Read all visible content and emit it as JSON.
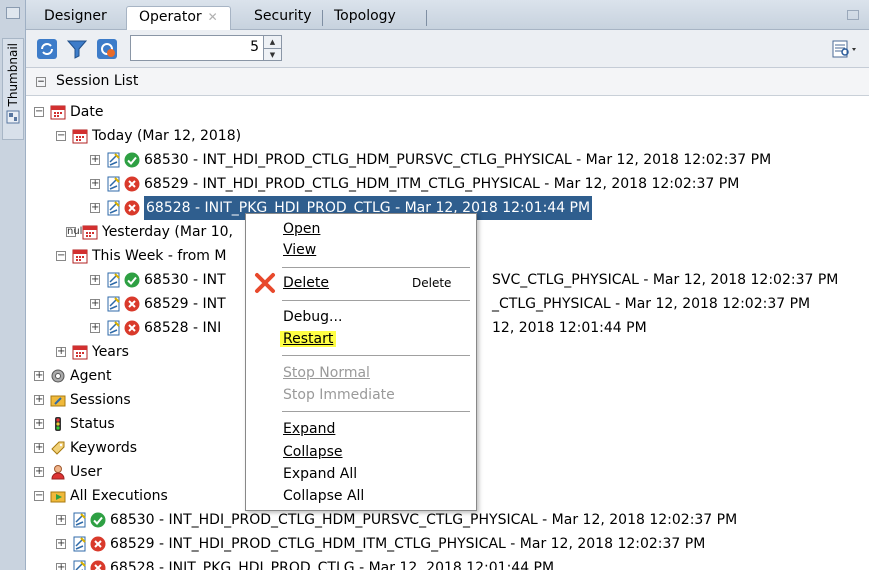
{
  "sidebar": {
    "label": "Thumbnail"
  },
  "tabs": [
    {
      "label": "Designer"
    },
    {
      "label": "Operator"
    },
    {
      "label": "Security"
    },
    {
      "label": "Topology"
    }
  ],
  "toolbar": {
    "spinner_value": "5"
  },
  "panel": {
    "title": "Session List"
  },
  "tree": {
    "date": "Date",
    "today": "Today (Mar 12, 2018)",
    "today_items": [
      {
        "text": "68530 - INT_HDI_PROD_CTLG_HDM_PURSVC_CTLG_PHYSICAL - Mar 12, 2018 12:02:37 PM",
        "status": "success"
      },
      {
        "text": "68529 - INT_HDI_PROD_CTLG_HDM_ITM_CTLG_PHYSICAL - Mar 12, 2018 12:02:37 PM",
        "status": "error"
      },
      {
        "text": "68528 - INIT_PKG_HDI_PROD_CTLG - Mar 12, 2018 12:01:44 PM",
        "status": "error"
      }
    ],
    "yesterday": "Yesterday (Mar 10,",
    "week": "This Week - from M",
    "week_items": [
      {
        "left": "68530 - INT",
        "right": "SVC_CTLG_PHYSICAL - Mar 12, 2018 12:02:37 PM",
        "status": "success"
      },
      {
        "left": "68529 - INT",
        "right": "_CTLG_PHYSICAL - Mar 12, 2018 12:02:37 PM",
        "status": "error"
      },
      {
        "left": "68528 - INI",
        "right": "12, 2018 12:01:44 PM",
        "status": "error"
      }
    ],
    "years": "Years",
    "nodes": [
      "Agent",
      "Sessions",
      "Status",
      "Keywords",
      "User",
      "All Executions"
    ],
    "all_items": [
      {
        "text": "68530 - INT_HDI_PROD_CTLG_HDM_PURSVC_CTLG_PHYSICAL - Mar 12, 2018 12:02:37 PM",
        "status": "success"
      },
      {
        "text": "68529 - INT_HDI_PROD_CTLG_HDM_ITM_CTLG_PHYSICAL - Mar 12, 2018 12:02:37 PM",
        "status": "error"
      },
      {
        "text": "68528 - INIT_PKG_HDI_PROD_CTLG - Mar 12, 2018 12:01:44 PM",
        "status": "error"
      }
    ]
  },
  "context_menu": {
    "open": "Open",
    "view": "View",
    "delete": "Delete",
    "delete_shortcut": "Delete",
    "debug": "Debug...",
    "restart": "Restart",
    "stop_normal": "Stop Normal",
    "stop_immediate": "Stop Immediate",
    "expand": "Expand",
    "collapse": "Collapse",
    "expand_all": "Expand All",
    "collapse_all": "Collapse All"
  },
  "colors": {
    "selection": "#2f5e8e",
    "highlight": "#ffff44",
    "success": "#2ea043",
    "error": "#d93a2b"
  }
}
